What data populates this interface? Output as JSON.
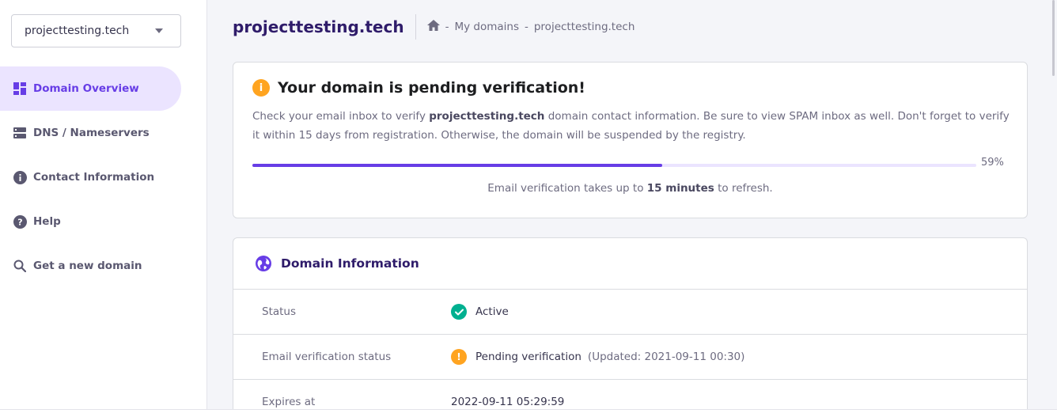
{
  "sidebar": {
    "domain_select": "projecttesting.tech",
    "items": [
      {
        "label": "Domain Overview",
        "icon": "dashboard-icon",
        "active": true
      },
      {
        "label": "DNS / Nameservers",
        "icon": "server-icon",
        "active": false
      },
      {
        "label": "Contact Information",
        "icon": "info-icon",
        "active": false
      },
      {
        "label": "Help",
        "icon": "help-icon",
        "active": false
      },
      {
        "label": "Get a new domain",
        "icon": "search-icon",
        "active": false
      }
    ]
  },
  "header": {
    "title": "projecttesting.tech",
    "breadcrumb": [
      "My domains",
      "projecttesting.tech"
    ],
    "separator": "-"
  },
  "alert": {
    "title": "Your domain is pending verification!",
    "body_prefix": "Check your email inbox to verify ",
    "body_domain": "projecttesting.tech",
    "body_suffix": " domain contact information. Be sure to view SPAM inbox as well. Don't forget to verify it within 15 days from registration. Otherwise, the domain will be suspended by the registry.",
    "progress_percent": 59,
    "progress_label": "59%",
    "note_prefix": "Email verification takes up to ",
    "note_bold": "15 minutes",
    "note_suffix": " to refresh."
  },
  "domain_info": {
    "title": "Domain Information",
    "rows": [
      {
        "label": "Status",
        "value": "Active",
        "extra": ""
      },
      {
        "label": "Email verification status",
        "value": "Pending verification",
        "extra": "(Updated: 2021-09-11 00:30)"
      },
      {
        "label": "Expires at",
        "value": "2022-09-11 05:29:59",
        "extra": ""
      }
    ]
  },
  "colors": {
    "accent": "#673de6",
    "success": "#00b090",
    "warning": "#ffa420"
  }
}
